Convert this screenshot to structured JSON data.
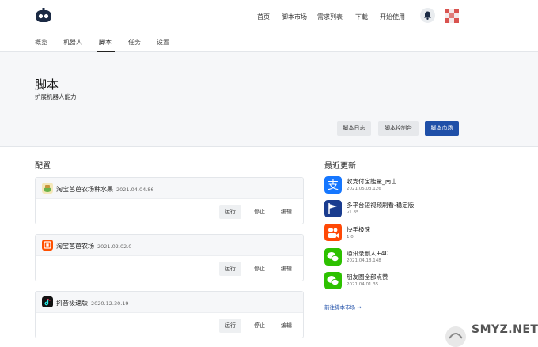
{
  "topnav": {
    "links": [
      "首页",
      "脚本市场",
      "需求列表",
      "下载",
      "开始使用"
    ]
  },
  "subnav": {
    "tabs": [
      "概览",
      "机器人",
      "脚本",
      "任务",
      "设置"
    ],
    "active": "脚本"
  },
  "header": {
    "title": "脚本",
    "subtitle": "扩展机器人能力",
    "buttons": {
      "log": "脚本日志",
      "console": "脚本控制台",
      "market": "脚本市场"
    }
  },
  "config": {
    "title": "配置",
    "cards": [
      {
        "name": "淘宝芭芭农场种水果",
        "version": "2021.04.04.86",
        "icon": "taobao-farm-fruit-icon"
      },
      {
        "name": "淘宝芭芭农场",
        "version": "2021.02.02.0",
        "icon": "taobao-icon"
      },
      {
        "name": "抖音极速版",
        "version": "2020.12.30.19",
        "icon": "douyin-icon"
      }
    ],
    "actions": {
      "run": "运行",
      "stop": "停止",
      "edit": "编辑"
    }
  },
  "recent": {
    "title": "最近更新",
    "items": [
      {
        "name": "收支付宝能量_南山",
        "version": "2021.05.03.126",
        "icon": "alipay-icon"
      },
      {
        "name": "多平台短视频刷看-稳定版",
        "version": "v1.85",
        "icon": "video-flag-icon"
      },
      {
        "name": "快手极速",
        "version": "1.0",
        "icon": "kuaishou-icon"
      },
      {
        "name": "通讯录删人+40",
        "version": "2021.04.18.148",
        "icon": "wechat-icon"
      },
      {
        "name": "朋友圈全部点赞",
        "version": "2021.04.01.35",
        "icon": "wechat-icon"
      }
    ],
    "more_link": "前往脚本市场 →"
  },
  "watermark": "SMYZ.NET",
  "colors": {
    "primary": "#1f4fa8",
    "header_bg": "#f6f7f9",
    "alipay": "#1677ff",
    "wechat": "#2dc100",
    "kuaishou": "#ff4906"
  }
}
